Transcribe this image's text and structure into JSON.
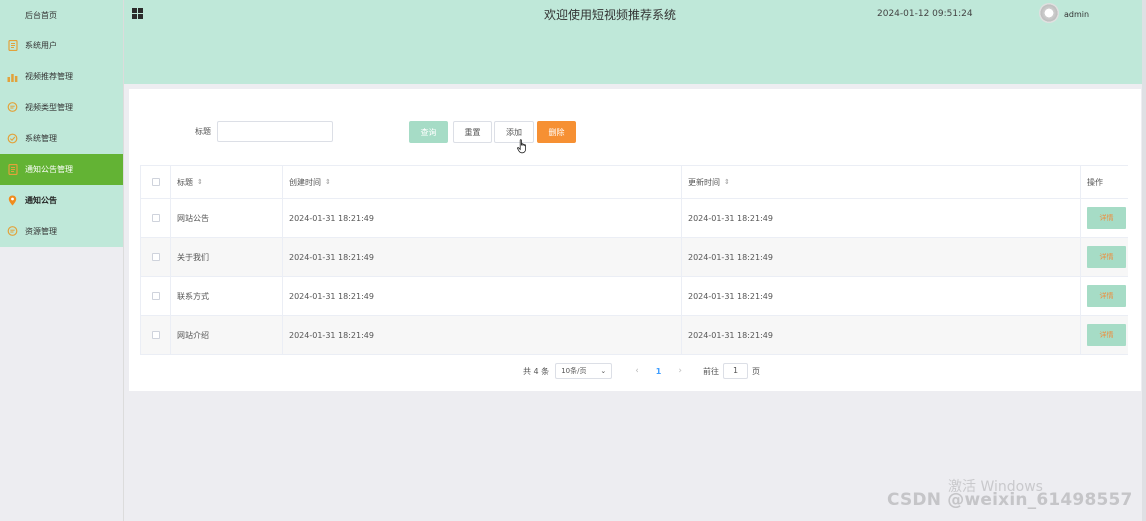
{
  "sidebar": {
    "items": [
      {
        "label": "后台首页",
        "icon": "home"
      },
      {
        "label": "系统用户",
        "icon": "document-icon"
      },
      {
        "label": "视频推荐管理",
        "icon": "bar-chart-icon"
      },
      {
        "label": "视频类型管理",
        "icon": "chat-icon"
      },
      {
        "label": "系统管理",
        "icon": "check-circle-icon"
      },
      {
        "label": "通知公告管理",
        "icon": "document-icon"
      },
      {
        "label": "通知公告",
        "icon": "location-icon"
      },
      {
        "label": "资源管理",
        "icon": "chat-icon"
      }
    ]
  },
  "header": {
    "title": "欢迎使用短视频推荐系统",
    "datetime": "2024-01-12 09:51:24",
    "user": "admin"
  },
  "search": {
    "label": "标题",
    "value": "",
    "placeholder": ""
  },
  "buttons": {
    "query": "查询",
    "reset": "重置",
    "add": "添加",
    "delete": "删除"
  },
  "table": {
    "columns": [
      "标题",
      "创建时间",
      "更新时间",
      "操作"
    ],
    "rows": [
      {
        "title": "网站公告",
        "created": "2024-01-31 18:21:49",
        "updated": "2024-01-31 18:21:49",
        "action": "详情"
      },
      {
        "title": "关于我们",
        "created": "2024-01-31 18:21:49",
        "updated": "2024-01-31 18:21:49",
        "action": "详情"
      },
      {
        "title": "联系方式",
        "created": "2024-01-31 18:21:49",
        "updated": "2024-01-31 18:21:49",
        "action": "详情"
      },
      {
        "title": "网站介绍",
        "created": "2024-01-31 18:21:49",
        "updated": "2024-01-31 18:21:49",
        "action": "详情"
      }
    ]
  },
  "pagination": {
    "total": "共 4 条",
    "page_size": "10条/页",
    "current": "1",
    "goto_label": "前往",
    "goto_value": "1",
    "page_suffix": "页"
  },
  "watermarks": {
    "windows": "激活 Windows",
    "csdn": "CSDN @weixin_61498557"
  },
  "colors": {
    "sidebar_bg": "#bfe8d9",
    "active": "#63b334",
    "delete": "#f69033",
    "query": "#a6dcc6"
  }
}
